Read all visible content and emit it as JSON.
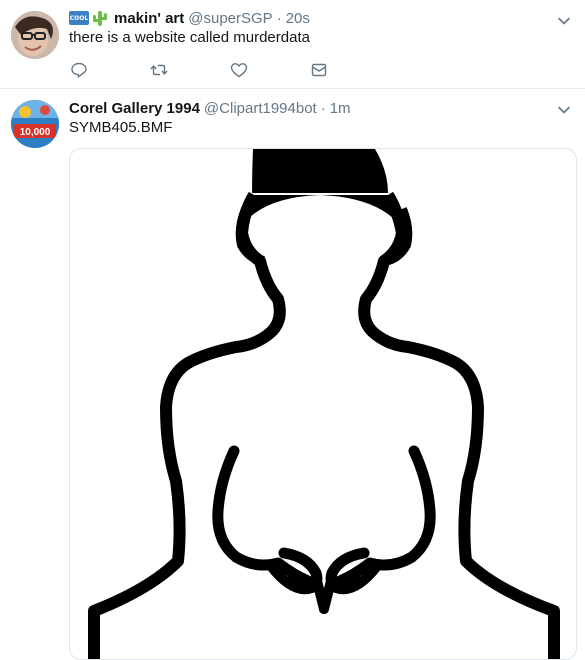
{
  "tweets": [
    {
      "display_name": "makin' art",
      "badge_text": "COOL",
      "handle": "@superSGP",
      "separator": "·",
      "time": "20s",
      "text": "there is a website called murderdata",
      "icons": [
        "reply-icon",
        "retweet-icon",
        "like-icon",
        "message-icon",
        "chevron-down-icon"
      ]
    },
    {
      "display_name": "Corel Gallery 1994",
      "handle": "@Clipart1994bot",
      "separator": "·",
      "time": "1m",
      "text": "SYMB405.BMF",
      "avatar_text": "10,000"
    }
  ],
  "colors": {
    "muted": "#657786",
    "icon": "#657786",
    "border": "#e6ecf0"
  }
}
